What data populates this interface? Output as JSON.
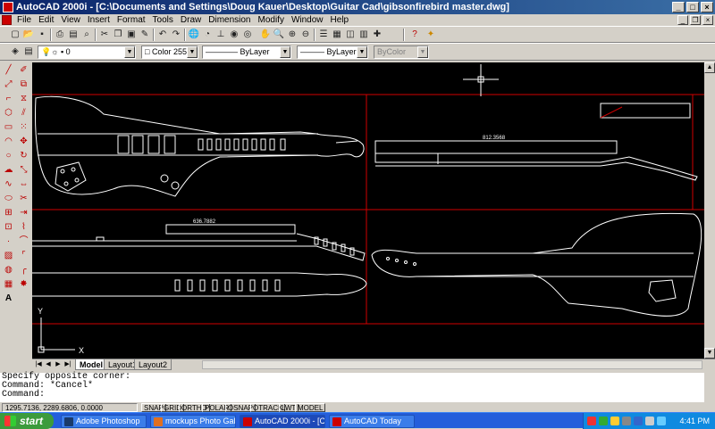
{
  "window": {
    "title": "AutoCAD 2000i - [C:\\Documents and Settings\\Doug Kauer\\Desktop\\Guitar Cad\\gibsonfirebird master.dwg]"
  },
  "menu": {
    "items": [
      "File",
      "Edit",
      "View",
      "Insert",
      "Format",
      "Tools",
      "Draw",
      "Dimension",
      "Modify",
      "Window",
      "Help"
    ]
  },
  "toolbar": {
    "layer_value": "0",
    "color_value": "Color 255",
    "linetype_value": "ByLayer",
    "lineweight_value": "ByLayer",
    "plotstyle_value": "ByColor"
  },
  "drawing": {
    "dimension_top": "812.3568",
    "dimension_bottom": "636.7882",
    "ucs_y": "Y",
    "ucs_x": "X",
    "colors": {
      "background": "#000000",
      "geometry": "#ffffff",
      "viewport_border": "#d00000",
      "crosshair": "#ffffff"
    }
  },
  "layout_tabs": [
    "Model",
    "Layout1",
    "Layout2"
  ],
  "command": {
    "lines": [
      "Specify opposite corner:",
      "Command: *Cancel*",
      "Command:"
    ]
  },
  "status": {
    "coords": "1295.7136, 2289.6806, 0.0000",
    "modes": [
      "SNAP",
      "GRID",
      "ORTHO",
      "POLAR",
      "OSNAP",
      "OTRACK",
      "LWT",
      "MODEL"
    ]
  },
  "taskbar": {
    "start_label": "start",
    "tasks": [
      "Adobe Photoshop",
      "mockups Photo Galler...",
      "AutoCAD 2000i - [C:\\...",
      "AutoCAD Today"
    ],
    "clock": "4:41 PM"
  }
}
